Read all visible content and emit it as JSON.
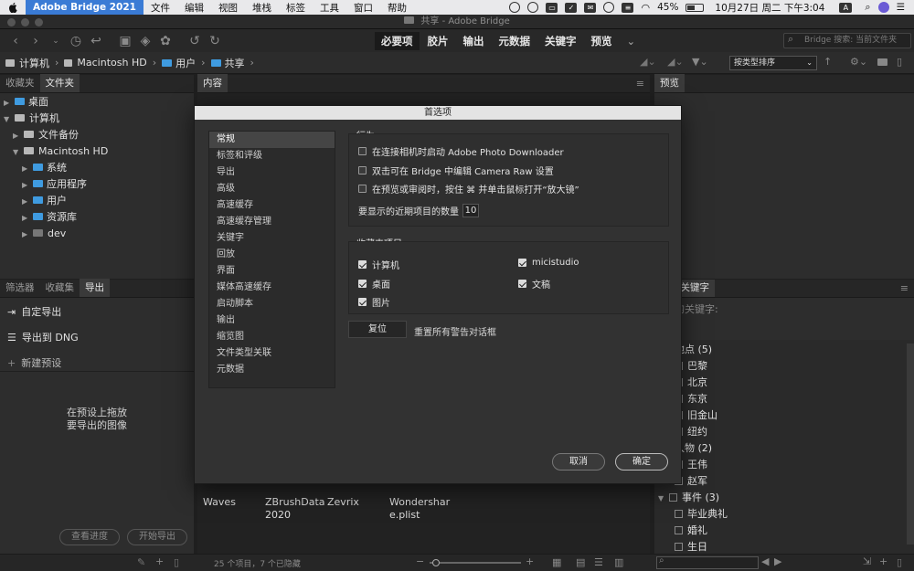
{
  "menubar": {
    "app_name": "Adobe Bridge 2021",
    "items": [
      "文件",
      "编辑",
      "视图",
      "堆栈",
      "标签",
      "工具",
      "窗口",
      "帮助"
    ],
    "battery": "45%",
    "clock": "10月27日 周二 下午3:04",
    "input_method": "A"
  },
  "window": {
    "title": "共享 - Adobe Bridge"
  },
  "toolbar": {
    "workspaces": [
      "必要项",
      "胶片",
      "输出",
      "元数据",
      "关键字",
      "预览"
    ],
    "search_placeholder": "Bridge 搜索: 当前文件夹"
  },
  "pathbar": {
    "crumbs": [
      "计算机",
      "Macintosh HD",
      "用户",
      "共享"
    ],
    "sort_label": "按类型排序"
  },
  "left_panel": {
    "tabs": [
      "收藏夹",
      "文件夹"
    ],
    "tree": [
      "桌面",
      "计算机",
      "文件备份",
      "Macintosh HD",
      "系统",
      "应用程序",
      "用户",
      "资源库",
      "dev"
    ]
  },
  "export_panel": {
    "tabs": [
      "筛选器",
      "收藏集",
      "导出"
    ],
    "items": [
      "自定导出",
      "导出到 DNG",
      "新建预设"
    ],
    "hint_line1": "在预设上拖放",
    "hint_line2": "要导出的图像",
    "progress_button": "查看进度",
    "start_button": "开始导出"
  },
  "content_panel": {
    "tab": "内容",
    "files": [
      {
        "line1": "Waves",
        "line2": ""
      },
      {
        "line1": "ZBrushData",
        "line2": "2020"
      },
      {
        "line1": "Zevrix",
        "line2": ""
      },
      {
        "line1": "Wondershar",
        "line2": "e.plist"
      }
    ],
    "status": "25 个项目，7 个已隐藏"
  },
  "preview_panel": {
    "tab": "预览"
  },
  "keywords_panel": {
    "tabs": [
      "据",
      "关键字"
    ],
    "assigned_label": "的关键字:",
    "groups": [
      {
        "name": "地点",
        "count": "(5)",
        "items": [
          "巴黎",
          "北京",
          "东京",
          "旧金山",
          "纽约"
        ]
      },
      {
        "name": "人物",
        "count": "(2)",
        "items": [
          "王伟",
          "赵军"
        ]
      },
      {
        "name": "事件",
        "count": "(3)",
        "items": [
          "毕业典礼",
          "婚礼",
          "生日"
        ]
      }
    ]
  },
  "dialog": {
    "title": "首选项",
    "categories": [
      "常规",
      "标签和评级",
      "导出",
      "高级",
      "高速缓存",
      "高速缓存管理",
      "关键字",
      "回放",
      "界面",
      "媒体高速缓存",
      "启动脚本",
      "输出",
      "缩览图",
      "文件类型关联",
      "元数据"
    ],
    "behavior": {
      "title": "行为",
      "options": [
        {
          "label": "在连接相机时启动 Adobe Photo Downloader",
          "checked": false
        },
        {
          "label": "双击可在 Bridge 中编辑 Camera Raw 设置",
          "checked": false
        },
        {
          "label": "在预览或审阅时，按住 ⌘ 并单击鼠标打开“放大镜”",
          "checked": false
        }
      ],
      "recent_label": "要显示的近期项目的数量",
      "recent_value": "10"
    },
    "favorites": {
      "title": "收藏夹项目",
      "items": [
        {
          "label": "计算机",
          "checked": true
        },
        {
          "label": "micistudio",
          "checked": true
        },
        {
          "label": "桌面",
          "checked": true
        },
        {
          "label": "文稿",
          "checked": true
        },
        {
          "label": "图片",
          "checked": true
        }
      ]
    },
    "reset_button": "复位",
    "reset_text": "重置所有警告对话框",
    "cancel_button": "取消",
    "ok_button": "确定"
  },
  "colors": {
    "accent": "#3a7bd5",
    "folder": "#3f9be0"
  }
}
